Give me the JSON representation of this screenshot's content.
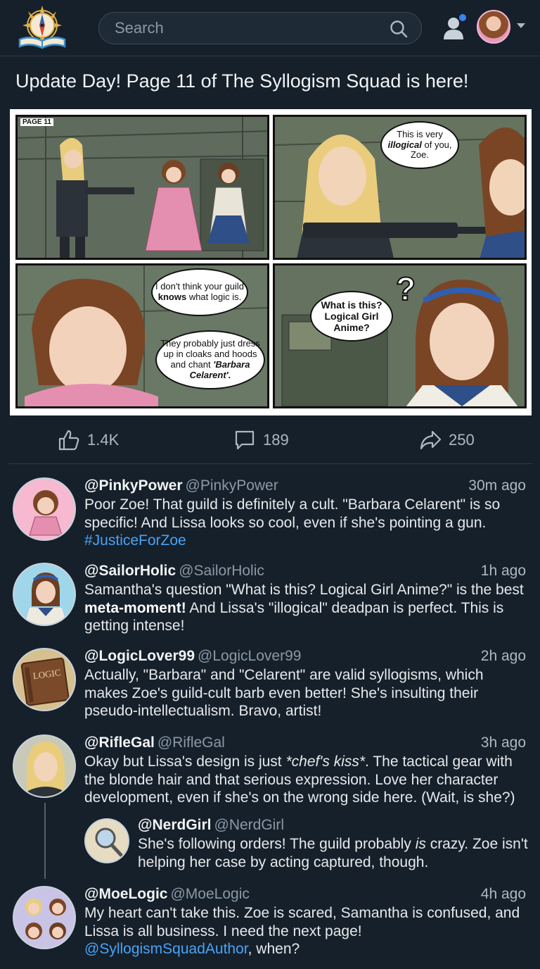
{
  "header": {
    "search_placeholder": "Search",
    "icons": {
      "logo": "compass-book-logo",
      "search": "search-icon",
      "notifications": "user-notification-icon",
      "menu": "chevron-down-icon"
    },
    "colors": {
      "background": "#15202b",
      "accent": "#4aa3f5",
      "notification_dot": "#3b82f6"
    }
  },
  "post": {
    "title": "Update Day! Page 11 of The Syllogism Squad is here!",
    "comic": {
      "page_tag": "PAGE 11",
      "panel2_bubble": [
        "This is very",
        "illogical",
        " of you, Zoe."
      ],
      "panel3_bubble_top": [
        "I don't think your guild ",
        "knows",
        " what logic is."
      ],
      "panel3_bubble_bottom": [
        "They probably just dress up in cloaks and hoods and chant ",
        "'Barbara Celarent'."
      ],
      "panel4_bubble": "What is this? Logical Girl Anime?",
      "panel4_mark": "?"
    },
    "actions": {
      "likes": "1.4K",
      "comments": "189",
      "shares": "250"
    }
  },
  "comments": [
    {
      "name": "@PinkyPower",
      "handle": "@PinkyPower",
      "time": "30m ago",
      "text": "Poor Zoe! That guild is definitely a cult. \"Barbara Celarent\" is so specific! And Lissa looks so cool, even if she's pointing a gun.",
      "hashtag": "#JusticeForZoe"
    },
    {
      "name": "@SailorHolic",
      "handle": "@SailorHolic",
      "time": "1h ago",
      "text_a": "Samantha's question \"What is this? Logical Girl Anime?\" is the best ",
      "bold": "meta-moment!",
      "text_b": " And Lissa's \"illogical\" deadpan is perfect. This is getting intense!"
    },
    {
      "name": "@LogicLover99",
      "handle": "@LogicLover99",
      "time": "2h ago",
      "text": "Actually, \"Barbara\" and \"Celarent\" are valid syllogisms, which makes Zoe's guild-cult barb even better! She's insulting their pseudo-intellectualism. Bravo, artist!",
      "avatar_label": "LOGIC"
    },
    {
      "name": "@RifleGal",
      "handle": "@RifleGal",
      "time": "3h ago",
      "text_a": "Okay but Lissa's design is just ",
      "italic": "*chef's kiss*",
      "text_b": ". The tactical gear with the blonde hair and that serious expression. Love her character development, even if she's on the wrong side here. (Wait, is she?)"
    },
    {
      "name": "@NerdGirl",
      "handle": "@NerdGirl",
      "time": "",
      "text_a": "She's following orders! The guild probably ",
      "italic": "is",
      "text_b": " crazy. Zoe isn't helping her case by acting captured, though."
    },
    {
      "name": "@MoeLogic",
      "handle": "@MoeLogic",
      "time": "4h ago",
      "text": "My heart can't take this. Zoe is scared, Samantha is confused, and Lissa is all business. I need the next page!",
      "mention": "@SyllogismSquadAuthor",
      "text_end": ", when?"
    }
  ]
}
